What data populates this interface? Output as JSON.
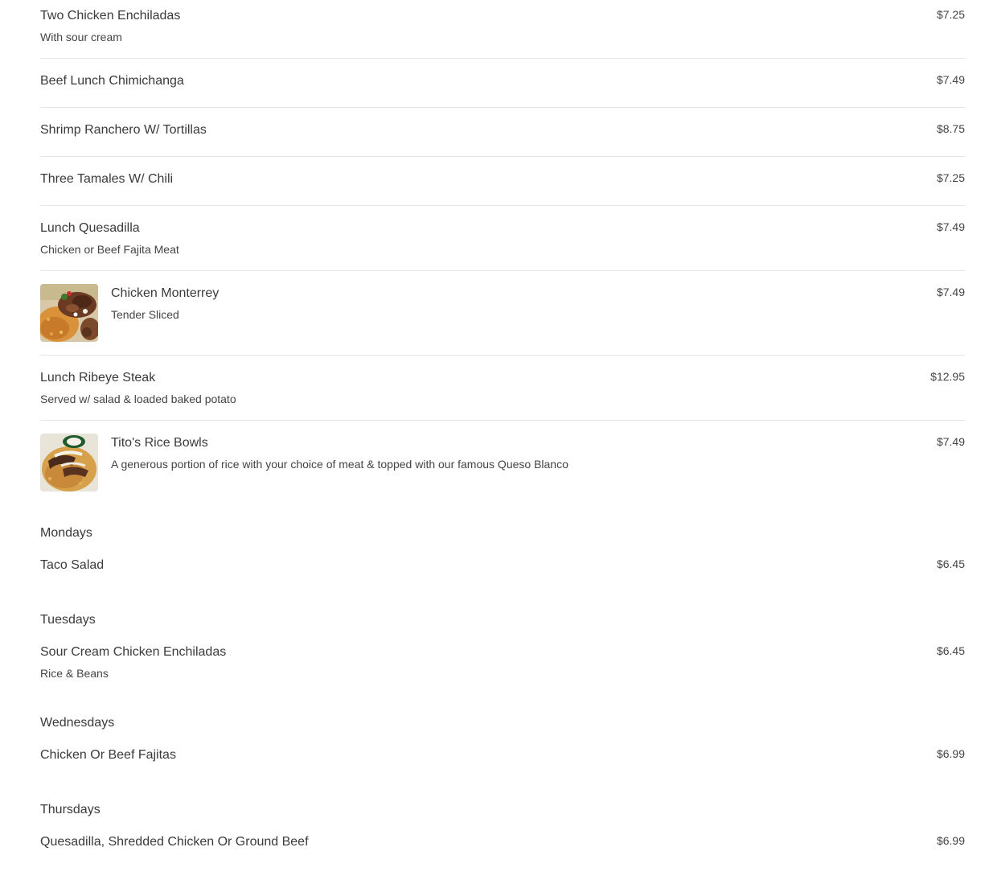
{
  "lunch_items": [
    {
      "name": "Two Chicken Enchiladas",
      "desc": "With sour cream",
      "price": "$7.25"
    },
    {
      "name": "Beef Lunch Chimichanga",
      "desc": "",
      "price": "$7.49"
    },
    {
      "name": "Shrimp Ranchero W/ Tortillas",
      "desc": "",
      "price": "$8.75"
    },
    {
      "name": "Three Tamales W/ Chili",
      "desc": "",
      "price": "$7.25"
    },
    {
      "name": "Lunch Quesadilla",
      "desc": "Chicken or Beef Fajita Meat",
      "price": "$7.49"
    },
    {
      "name": "Chicken Monterrey",
      "desc": "Tender Sliced",
      "price": "$7.49"
    },
    {
      "name": "Lunch Ribeye Steak",
      "desc": "Served w/ salad & loaded baked potato",
      "price": "$12.95"
    },
    {
      "name": "Tito's Rice Bowls",
      "desc": "A generous portion of rice with your choice of meat & topped with our famous Queso Blanco",
      "price": "$7.49"
    }
  ],
  "specials": [
    {
      "day": "Mondays",
      "name": "Taco Salad",
      "desc": "",
      "price": "$6.45"
    },
    {
      "day": "Tuesdays",
      "name": "Sour Cream Chicken Enchiladas",
      "desc": "Rice & Beans",
      "price": "$6.45"
    },
    {
      "day": "Wednesdays",
      "name": "Chicken Or Beef Fajitas",
      "desc": "",
      "price": "$6.99"
    },
    {
      "day": "Thursdays",
      "name": "Quesadilla, Shredded Chicken Or Ground Beef",
      "desc": "",
      "price": "$6.99"
    }
  ]
}
